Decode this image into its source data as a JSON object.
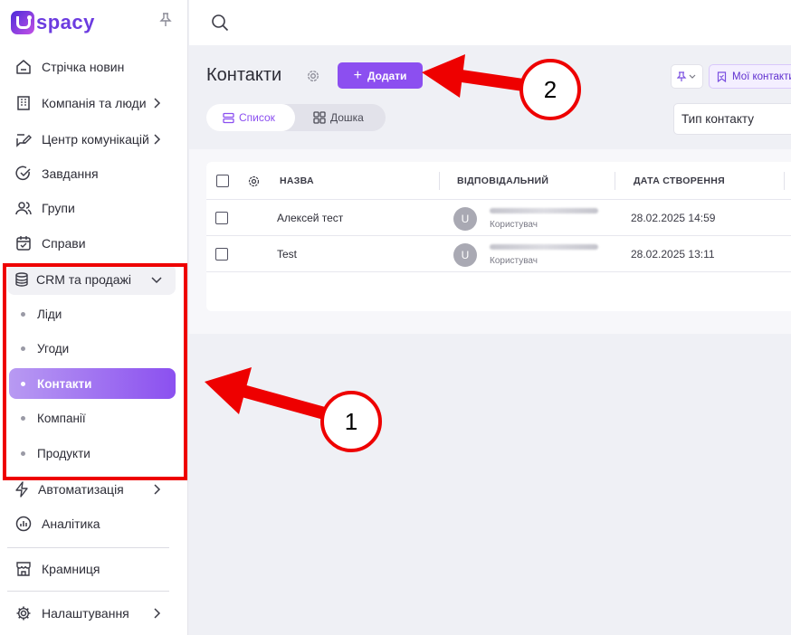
{
  "app": {
    "logo_text": "spacy"
  },
  "sidebar": {
    "items": [
      {
        "label": "Стрічка новин",
        "icon": "home-icon"
      },
      {
        "label": "Компанія та люди",
        "icon": "building-icon"
      },
      {
        "label": "Центр комунікацій",
        "icon": "chat-edit-icon"
      },
      {
        "label": "Завдання",
        "icon": "check-circle-icon"
      },
      {
        "label": "Групи",
        "icon": "users-icon"
      },
      {
        "label": "Справи",
        "icon": "calendar-check-icon"
      }
    ],
    "crm": {
      "label": "CRM та продажі",
      "icon": "database-icon",
      "children": [
        "Ліди",
        "Угоди",
        "Контакти",
        "Компанії",
        "Продукти"
      ],
      "active": "Контакти"
    },
    "bottom_items": [
      {
        "label": "Автоматизація",
        "icon": "lightning-icon"
      },
      {
        "label": "Аналітика",
        "icon": "analytics-icon"
      },
      {
        "label": "Крамниця",
        "icon": "store-icon"
      },
      {
        "label": "Налаштування",
        "icon": "settings-icon"
      }
    ]
  },
  "page": {
    "title": "Контакти",
    "add_button": "Додати",
    "views": {
      "list": "Список",
      "board": "Дошка"
    },
    "my_contacts": "Мої контакти",
    "type_filter": "Тип контакту"
  },
  "table": {
    "columns": [
      "НАЗВА",
      "ВІДПОВІДАЛЬНИЙ",
      "ДАТА СТВОРЕННЯ"
    ],
    "rows": [
      {
        "name": "Алексей тест",
        "avatar": "U",
        "role": "Користувач",
        "created": "28.02.2025 14:59"
      },
      {
        "name": "Test",
        "avatar": "U",
        "role": "Користувач",
        "created": "28.02.2025 13:11"
      }
    ]
  },
  "annotations": {
    "badge_1": "1",
    "badge_2": "2"
  },
  "colors": {
    "accent": "#8c4ff0",
    "annotation": "#ee0000"
  }
}
